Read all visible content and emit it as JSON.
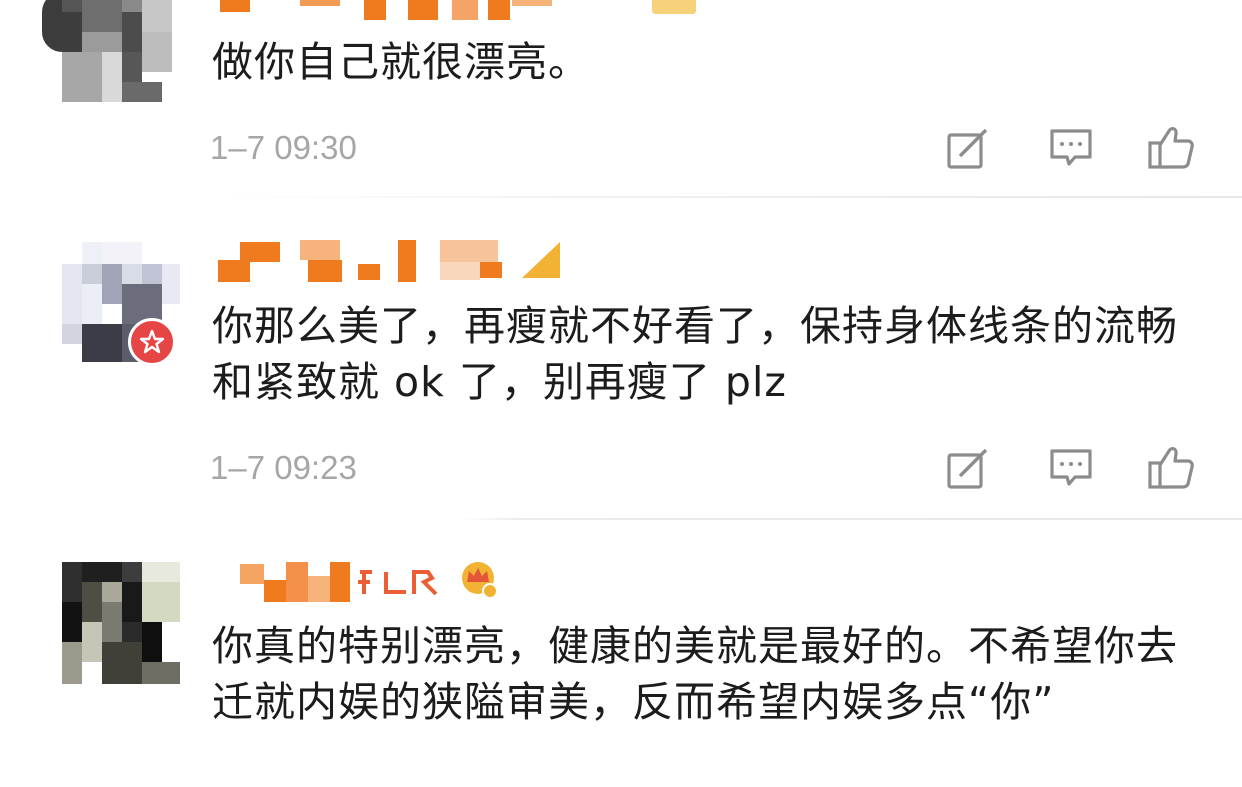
{
  "comments": [
    {
      "text": "做你自己就很漂亮。",
      "time": "1–7 09:30"
    },
    {
      "text": "你那么美了，再瘦就不好看了，保持身体线条的流畅和紧致就 ok 了，别再瘦了 plz",
      "time": "1–7 09:23"
    },
    {
      "text": "你真的特别漂亮，健康的美就是最好的。不希望你去迁就内娱的狭隘审美，反而希望内娱多点“你”"
    }
  ],
  "icons": {
    "repost": "repost-icon",
    "comment": "comment-icon",
    "like": "thumbs-up-icon"
  },
  "colors": {
    "username_mosaic": "#f07a1e",
    "timestamp": "#a6a6a6",
    "verified_badge": "#e64545",
    "rank_badge": "#f2b233"
  }
}
